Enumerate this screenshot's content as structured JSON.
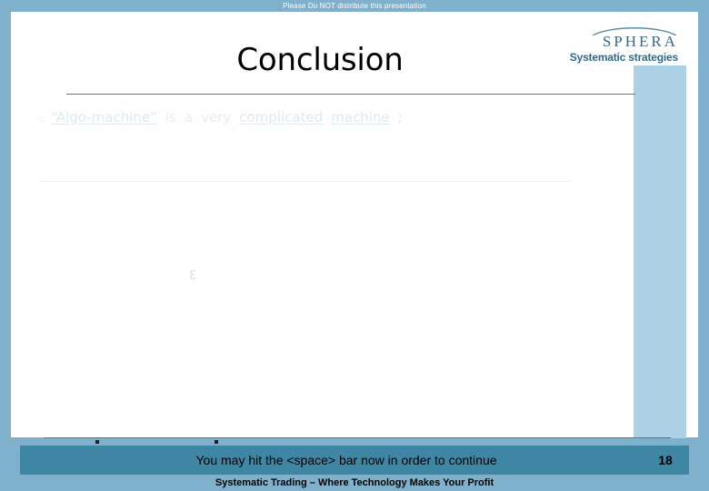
{
  "notice": {
    "text": "Please Do NOT distribute this presentation"
  },
  "header": {
    "title": "Conclusion"
  },
  "logo": {
    "wordmark": "SPHERA",
    "tagline": "Systematic strategies",
    "arc_icon": "arc-swoosh-icon"
  },
  "body": {
    "bullets": [
      {
        "marker": "▫",
        "fragments": [
          {
            "text": "“Algo-machine”",
            "style": "hl"
          },
          {
            "text": "is",
            "style": "dim"
          },
          {
            "text": "a",
            "style": "dim"
          },
          {
            "text": "very",
            "style": "dim"
          },
          {
            "text": "complicated",
            "style": "hl"
          },
          {
            "text": "machine",
            "style": "hl"
          },
          {
            "text": ";",
            "style": "tail"
          }
        ]
      }
    ],
    "ghost_glyph": "Ɛ"
  },
  "prompt": {
    "text": "You may hit the <space> bar now in order to continue",
    "page_number": "18"
  },
  "footer": {
    "text": "Systematic Trading – Where Technology Makes Your Profit"
  },
  "colors": {
    "frame_blue": "#7fb0cc",
    "panel_blue": "#acd0e4",
    "rule_teal": "#3e7f9e",
    "prompt_teal": "#3f86a4",
    "logo_blue": "#3d6a83",
    "highlight_text": "#dde9f2",
    "dim_text": "#e9eced"
  }
}
